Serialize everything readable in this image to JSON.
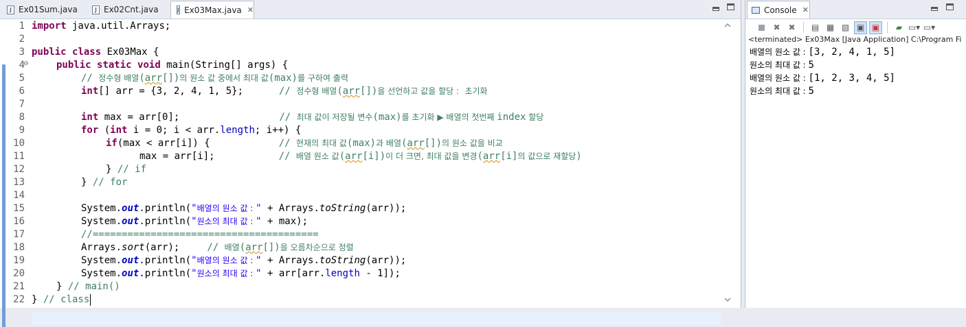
{
  "editor": {
    "tabs": [
      {
        "label": "Ex01Sum.java"
      },
      {
        "label": "Ex02Cnt.java"
      },
      {
        "label": "Ex03Max.java",
        "active": true
      }
    ],
    "line_numbers": [
      "1",
      "2",
      "3",
      "4",
      "5",
      "6",
      "7",
      "8",
      "9",
      "10",
      "11",
      "12",
      "13",
      "14",
      "15",
      "16",
      "17",
      "18",
      "19",
      "20",
      "21",
      "22"
    ],
    "lines": {
      "l1": {
        "kw": "import",
        "rest": " java.util.Arrays;"
      },
      "l3": {
        "kw1": "public",
        "kw2": "class",
        "rest": " Ex03Max {"
      },
      "l4": {
        "kw1": "public",
        "kw2": "static",
        "kw3": "void",
        "rest": " main(String[] args) {"
      },
      "l5": {
        "c1": "// ",
        "c2": "정수형 배열",
        "c3": "(",
        "c4": "arr",
        "c5": "[])",
        "c6": "의 원소 값 중에서 최대 값",
        "c7": "(max)",
        "c8": "를 구하여 출력"
      },
      "l6": {
        "kw": "int",
        "code": "[] arr = {3, 2, 4, 1, 5};",
        "c1": "// ",
        "c2": "정수형 배열",
        "c3": "(",
        "c4": "arr",
        "c5": "[])",
        "c6": "을 선언하고 값을 할당 :",
        "c7": " ",
        "c8": "초기화"
      },
      "l8": {
        "kw": "int",
        "code": " max = arr[0];",
        "c1": "// ",
        "c2": "최대 값이 저장될 변수",
        "c3": "(max)",
        "c4": "를 초기화 ▶ 배열의 첫번째 ",
        "c5": "index",
        "c6": " 할당"
      },
      "l9": {
        "kw1": "for",
        "p1": " (",
        "kw2": "int",
        "p2": " i = 0; i < arr.",
        "field": "length",
        "p3": "; i++) {"
      },
      "l10": {
        "kw": "if",
        "code": "(max < arr[i]) {",
        "c1": "// ",
        "c2": "현재의 최대 값",
        "c3": "(max)",
        "c4": "과 배열",
        "c5": "(",
        "c6": "arr",
        "c7": "[])",
        "c8": "의 원소 값을 비교"
      },
      "l11": {
        "code": "max = arr[i];",
        "c1": "// ",
        "c2": "배열 원소 값",
        "c3": "(",
        "c4": "arr",
        "c5": "[i])",
        "c6": "이 더 크면, 최대 값을 변경",
        "c7": "(",
        "c8": "arr",
        "c9": "[i]",
        "c10": "의 값으로 재할당",
        "c11": ")"
      },
      "l12": {
        "code": "} ",
        "cm": "// if"
      },
      "l13": {
        "code": "} ",
        "cm": "// for"
      },
      "l15": {
        "p1": "System.",
        "out": "out",
        "p2": ".println(",
        "s1": "\"",
        "s2": "배열의 원소 값 : ",
        "s3": "\"",
        "p3": " + Arrays.",
        "method": "toString",
        "p4": "(arr));"
      },
      "l16": {
        "p1": "System.",
        "out": "out",
        "p2": ".println(",
        "s1": "\"",
        "s2": "원소의 최대 값 : ",
        "s3": "\"",
        "p3": " + max);"
      },
      "l17": {
        "cm": "//======================================="
      },
      "l18": {
        "p1": "Arrays.",
        "method": "sort",
        "p2": "(arr);",
        "c1": "// ",
        "c2": "배열",
        "c3": "(",
        "c4": "arr",
        "c5": "[])",
        "c6": "을 오름차순으로 정렬"
      },
      "l19": {
        "p1": "System.",
        "out": "out",
        "p2": ".println(",
        "s1": "\"",
        "s2": "배열의 원소 값 : ",
        "s3": "\"",
        "p3": " + Arrays.",
        "method": "toString",
        "p4": "(arr));"
      },
      "l20": {
        "p1": "System.",
        "out": "out",
        "p2": ".println(",
        "s1": "\"",
        "s2": "원소의 최대 값 : ",
        "s3": "\"",
        "p3": " + arr[arr.",
        "field": "length",
        "p4": " - 1]);"
      },
      "l21": {
        "code": "} ",
        "cm": "// main()"
      },
      "l22": {
        "code": "} ",
        "cm": "// class"
      }
    }
  },
  "console": {
    "tab_label": "Console",
    "status": "<terminated> Ex03Max [Java Application] C:\\Program Fi",
    "toolbar_icons": [
      "stop-icon",
      "remove-launch-icon",
      "remove-all-icon",
      "clear-console-icon",
      "scroll-lock-icon",
      "word-wrap-icon",
      "show-on-stdout-icon",
      "show-on-stderr-icon",
      "pin-console-icon",
      "display-console-icon",
      "open-console-icon"
    ],
    "output": [
      {
        "label": "배열의 원소 값 : ",
        "value": "[3, 2, 4, 1, 5]"
      },
      {
        "label": "원소의 최대 값 : ",
        "value": "5"
      },
      {
        "label": "배열의 원소 값 : ",
        "value": "[1, 2, 3, 4, 5]"
      },
      {
        "label": "원소의 최대 값 : ",
        "value": "5"
      }
    ]
  }
}
